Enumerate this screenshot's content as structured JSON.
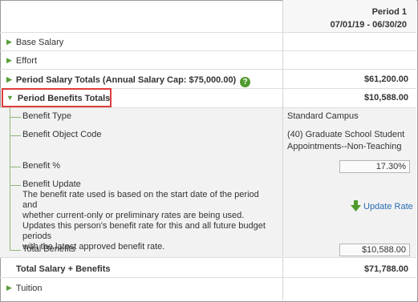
{
  "period": {
    "label": "Period 1",
    "dates": "07/01/19 - 06/30/20"
  },
  "rows": {
    "base_salary": {
      "label": "Base Salary"
    },
    "effort": {
      "label": "Effort"
    },
    "period_salary_totals": {
      "label": "Period Salary Totals (Annual Salary Cap: $75,000.00)",
      "help_icon": "?",
      "amount": "$61,200.00"
    },
    "period_benefits_totals": {
      "label": "Period Benefits Totals",
      "amount": "$10,588.00"
    },
    "total_salary_benefits": {
      "label": "Total Salary + Benefits",
      "amount": "$71,788.00"
    },
    "tuition": {
      "label": "Tuition"
    }
  },
  "benefits": {
    "benefit_type": {
      "label": "Benefit Type",
      "value": "Standard Campus"
    },
    "benefit_object_code": {
      "label": "Benefit Object Code",
      "value_line1": "(40) Graduate School Student",
      "value_line2": "Appointments--Non-Teaching"
    },
    "benefit_percent": {
      "label": "Benefit %",
      "value": "17.30%"
    },
    "benefit_update": {
      "label": "Benefit Update",
      "desc1_line1": "The benefit rate used is based on the start date of the period and",
      "desc1_line2": "whether current-only or preliminary rates are being used.",
      "desc2_line1": "Updates this person's benefit rate for this and all future budget periods",
      "desc2_line2": "with the latest approved benefit rate.",
      "action": "Update Rate"
    },
    "total_benefits": {
      "label": "Total Benefits",
      "value": "$10,588.00"
    }
  },
  "icons": {
    "expand_arrow": "triangle-right-icon",
    "collapse_arrow": "triangle-down-icon",
    "help": "question-circle-icon",
    "update": "arrow-down-icon"
  },
  "colors": {
    "accent_green": "#5a9e3a",
    "link_blue": "#2a6db3",
    "highlight_red": "#e03c3c"
  }
}
